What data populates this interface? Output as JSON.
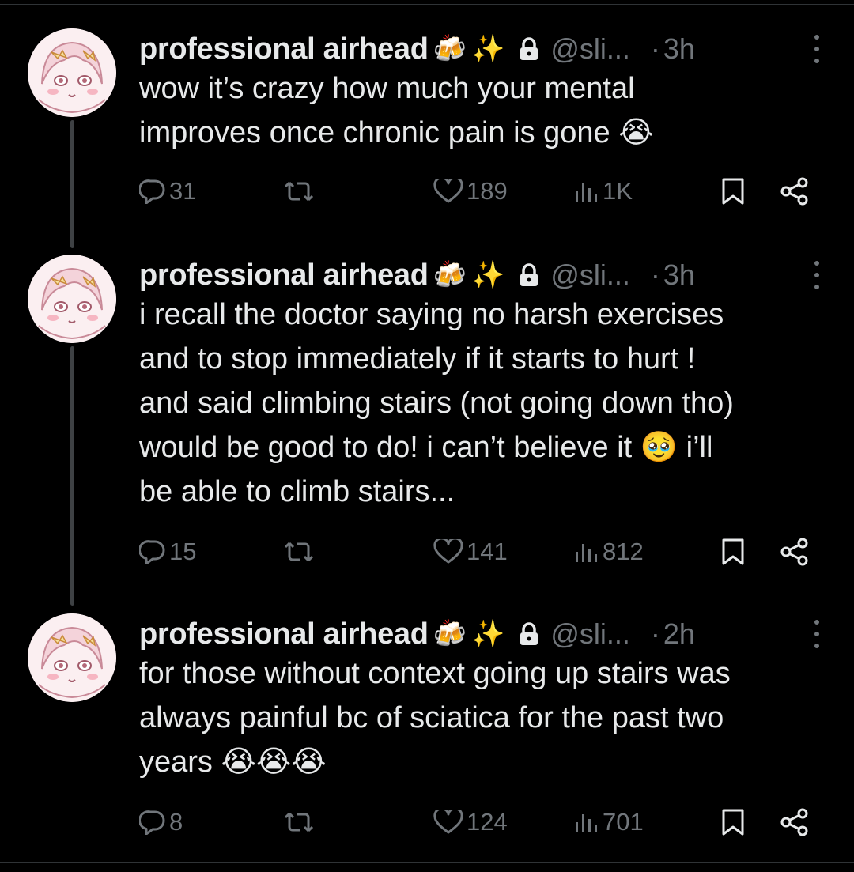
{
  "tweets": [
    {
      "name": "professional airhead",
      "name_emojis": [
        "🍻",
        "✨"
      ],
      "handle": "@sli...",
      "dot": "·",
      "time": "3h",
      "text": "wow it’s crazy how much your mental\nimproves once chronic pain is gone 😭",
      "replies": "31",
      "reposts": "",
      "likes": "189",
      "views": "1K"
    },
    {
      "name": "professional airhead",
      "name_emojis": [
        "🍻",
        "✨"
      ],
      "handle": "@sli...",
      "dot": "·",
      "time": "3h",
      "text": "i recall the doctor saying no harsh exercises\nand to stop immediately if it starts to hurt !\nand said climbing stairs (not going down tho)\nwould be good to do! i can’t believe it 🥹 i’ll\nbe able to climb stairs...",
      "replies": "15",
      "reposts": "",
      "likes": "141",
      "views": "812"
    },
    {
      "name": "professional airhead",
      "name_emojis": [
        "🍻",
        "✨"
      ],
      "handle": "@sli...",
      "dot": "·",
      "time": "2h",
      "text": "for those without context going up stairs was\nalways painful bc of sciatica for the past two\nyears 😭😭😭",
      "replies": "8",
      "reposts": "",
      "likes": "124",
      "views": "701"
    }
  ],
  "icons": {
    "reply": "reply-icon",
    "repost": "repost-icon",
    "like": "heart-icon",
    "views": "views-icon",
    "bookmark": "bookmark-icon",
    "share": "share-icon",
    "lock": "lock-icon",
    "more": "more-icon"
  },
  "colors": {
    "background": "#000000",
    "text": "#e7e9ea",
    "secondary": "#71767b",
    "divider": "#2f3336",
    "thread_line": "#3e4144"
  }
}
